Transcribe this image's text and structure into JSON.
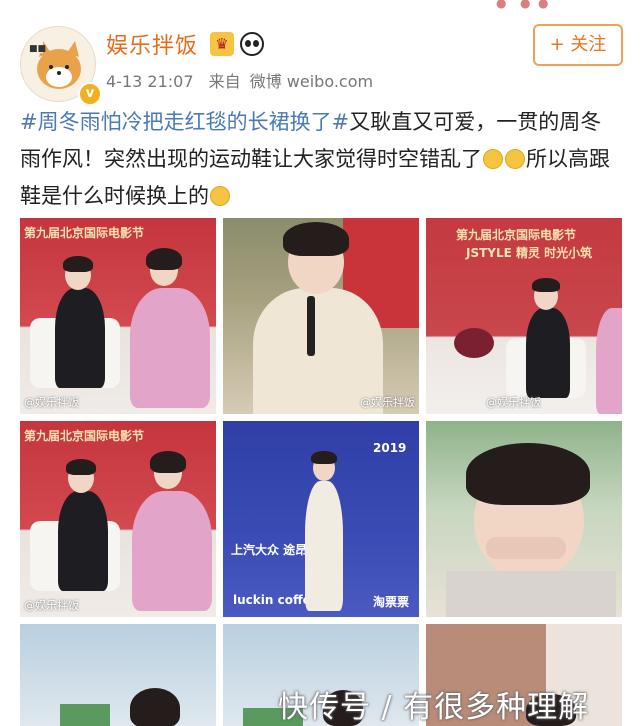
{
  "header": {
    "username": "娱乐拌饭",
    "time": "4-13 21:07",
    "source_prefix": "来自",
    "source": "微博 weibo.com",
    "follow_label": "+ 关注"
  },
  "post": {
    "hashtag": "#周冬雨怕冷把走红毯的长裙换了#",
    "text_1": "又耿直又可爱，一贯的周冬雨作风！突然出现的运动鞋让大家觉得时空错乱了",
    "text_2": "所以高跟鞋是什么时候换上的"
  },
  "images": {
    "wm_1": "@娱乐拌饭",
    "wm_2": "@娱乐拌饭",
    "wm_3": "@娱乐拌饭",
    "wm_4": "@娱乐拌饭",
    "sign_film_fest": "第九届北京国际电影节",
    "sign_jstyle": "JSTYLE 精灵 时光小筑",
    "sign_2019": "2019",
    "sign_luckin": "luckin coffee",
    "sign_maoyan": "淘票票",
    "sign_vw": "上汽大众 途昂"
  },
  "footer_watermark": "快传号 / 有很多种理解",
  "colors": {
    "username": "#e86b1a",
    "hashtag": "#4a79b8",
    "follow_border": "#f0a057"
  }
}
